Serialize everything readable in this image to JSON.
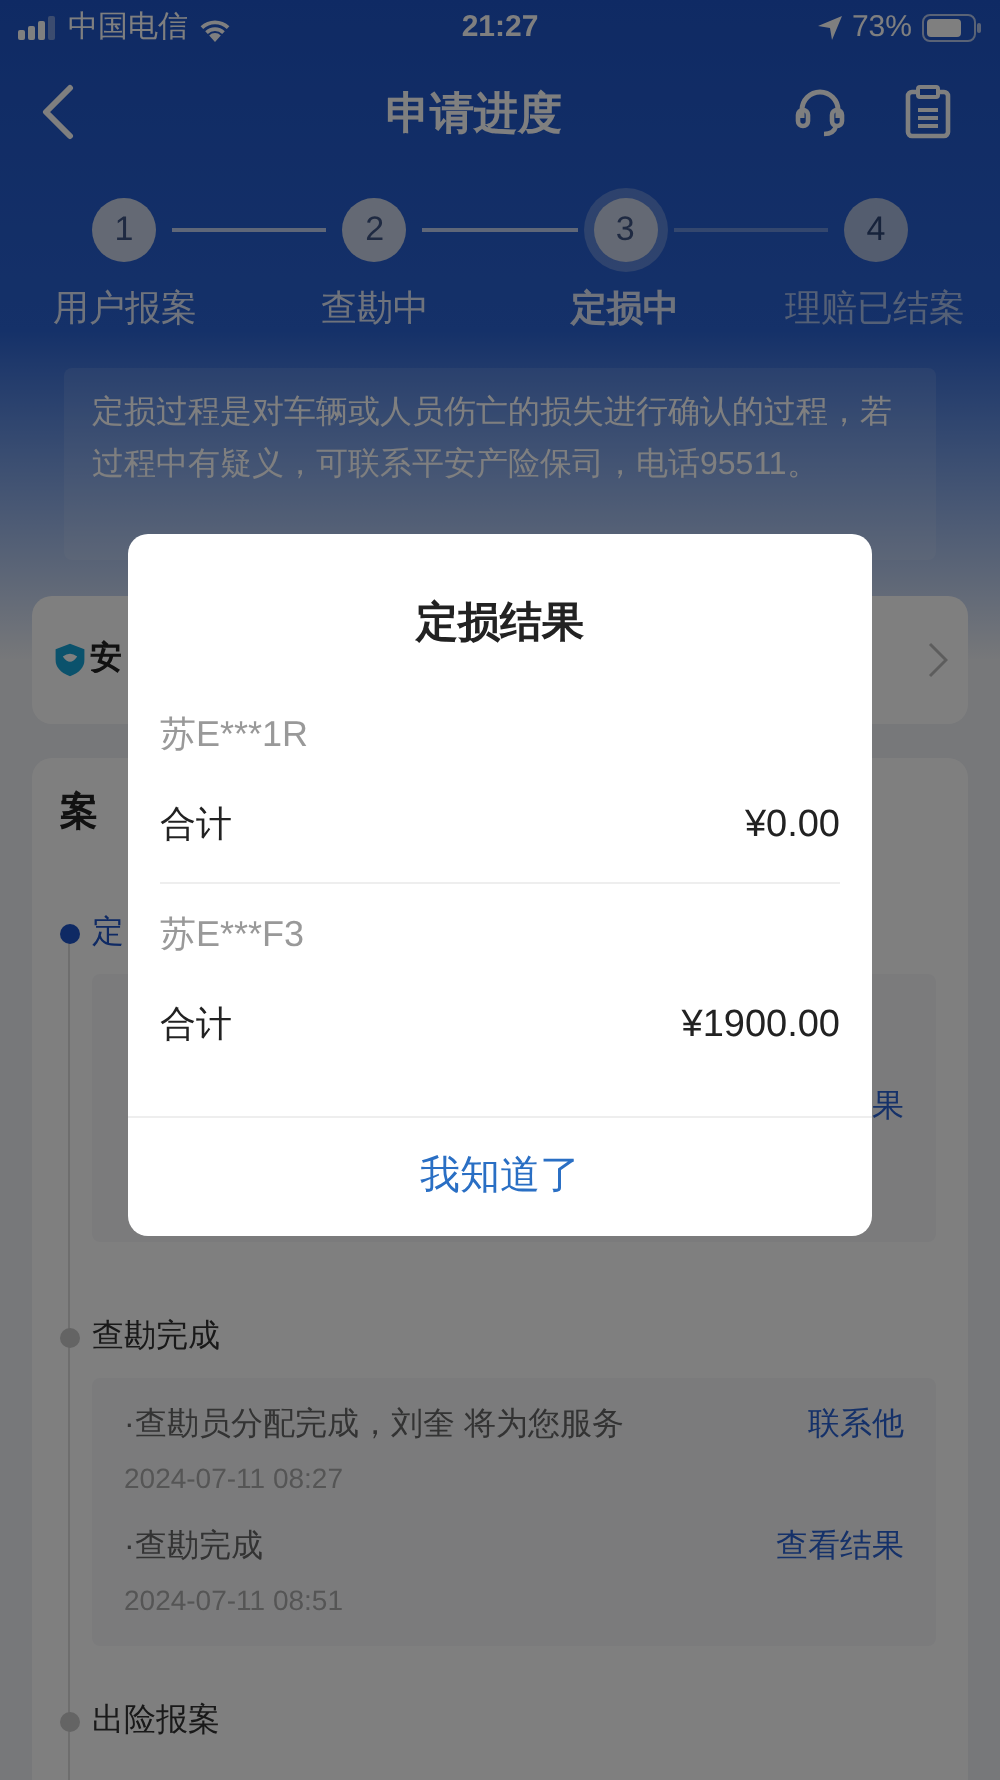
{
  "status_bar": {
    "carrier": "中国电信",
    "time": "21:27",
    "battery": "73%"
  },
  "nav": {
    "title": "申请进度"
  },
  "steps": [
    {
      "number": "1",
      "label": "用户报案",
      "reached": true,
      "selected": false
    },
    {
      "number": "2",
      "label": "查勘中",
      "reached": true,
      "selected": false
    },
    {
      "number": "3",
      "label": "定损中",
      "reached": true,
      "selected": true
    },
    {
      "number": "4",
      "label": "理赔已结案",
      "reached": false,
      "selected": false
    }
  ],
  "tip": "定损过程是对车辆或人员伤亡的损失进行确认的过程，若过程中有疑义，可联系平安产险保司，电话95511。",
  "banner": {
    "text": "安"
  },
  "case_card": {
    "title": "案",
    "stages": [
      {
        "title": "定",
        "current": true,
        "entries": [
          {
            "link": "果"
          }
        ]
      },
      {
        "title": "查勘完成",
        "current": false,
        "entries": [
          {
            "text": "·查勘员分配完成，刘奎 将为您服务",
            "time": "2024-07-11 08:27",
            "link": "联系他"
          },
          {
            "text": "·查勘完成",
            "time": "2024-07-11 08:51",
            "link": "查看结果"
          }
        ]
      },
      {
        "title": "出险报案",
        "current": false
      }
    ]
  },
  "dialog": {
    "title": "定损结果",
    "vehicles": [
      {
        "plate": "苏E***1R",
        "total_label": "合计",
        "total": "¥0.00"
      },
      {
        "plate": "苏E***F3",
        "total_label": "合计",
        "total": "¥1900.00"
      }
    ],
    "button": "我知道了"
  }
}
